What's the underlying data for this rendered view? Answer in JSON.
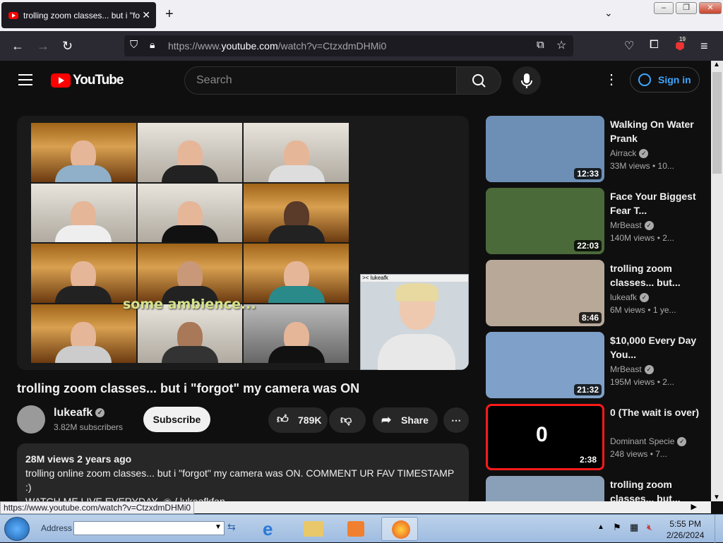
{
  "browser": {
    "tab_title": "trolling zoom classes... but i \"fo",
    "url_prefix": "https://www.",
    "url_domain": "youtube.com",
    "url_path": "/watch?v=CtzxdmDHMi0",
    "ext_badge": "19",
    "status_url": "https://www.youtube.com/watch?v=CtzxdmDHMi0"
  },
  "header": {
    "logo": "YouTube",
    "search_placeholder": "Search",
    "sign_in": "Sign in"
  },
  "video": {
    "overlay_caption": "some ambience...",
    "pip_label": ">< lukeafk",
    "title": "trolling zoom classes... but i \"forgot\" my camera was ON",
    "channel": "lukeafk",
    "subscribers": "3.82M subscribers",
    "subscribe_label": "Subscribe",
    "likes": "789K",
    "share_label": "Share",
    "views_date": "28M views  2 years ago",
    "desc_line1": "trolling online zoom classes... but i \"forgot\" my camera was ON. COMMENT UR FAV TIMESTAMP :)",
    "desc_line2_prefix": "WATCH ME LIVE EVERYDAY-",
    "desc_line2_link": " / lukeafkfan"
  },
  "recommendations": [
    {
      "title": "Walking On Water Prank",
      "channel": "Airrack",
      "views": "33M views  • 10...",
      "duration": "12:33",
      "color": "#6d8fb6"
    },
    {
      "title": "Face Your Biggest Fear T...",
      "channel": "MrBeast",
      "views": "140M views  • 2...",
      "duration": "22:03",
      "color": "#4a6a3a"
    },
    {
      "title": "trolling zoom classes... but...",
      "channel": "lukeafk",
      "views": "6M views  • 1 ye...",
      "duration": "8:46",
      "color": "#b8a898"
    },
    {
      "title": "$10,000 Every Day You...",
      "channel": "MrBeast",
      "views": "195M views  • 2...",
      "duration": "21:32",
      "color": "#7fa0c8"
    },
    {
      "title": "0 (The wait is over)",
      "channel": "Dominant Specie",
      "views": "248 views  • 7...",
      "duration": "2:38",
      "color": "#000000"
    },
    {
      "title": "trolling zoom classes... but...",
      "channel": "",
      "views": "",
      "duration": "",
      "color": "#8aa0b8"
    }
  ],
  "taskbar": {
    "address_label": "Address",
    "time": "5:55 PM",
    "date": "2/26/2024"
  }
}
